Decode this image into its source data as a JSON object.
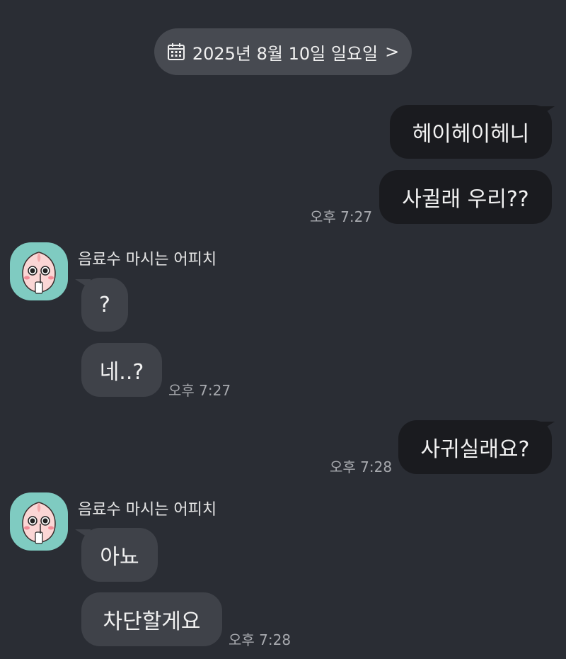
{
  "date_header": {
    "text": "2025년 8월 10일 일요일",
    "chevron": ">",
    "icon": "calendar-icon"
  },
  "messages": [
    {
      "from": "me",
      "text": "헤이헤이헤니"
    },
    {
      "from": "me",
      "text": "사귈래 우리??",
      "time": "오후 7:27"
    },
    {
      "from": "them",
      "sender": "음료수 마시는 어피치",
      "text": "?"
    },
    {
      "from": "them",
      "text": "네..?",
      "time": "오후 7:27"
    },
    {
      "from": "me",
      "text": "사귀실래요?",
      "time": "오후 7:28"
    },
    {
      "from": "them",
      "sender": "음료수 마시는 어피치",
      "text": "아뇨"
    },
    {
      "from": "them",
      "text": "차단할게요",
      "time": "오후 7:28"
    }
  ],
  "colors": {
    "background": "#2a2d34",
    "my_bubble": "#1a1b1f",
    "their_bubble": "#3f4249",
    "avatar_bg": "#7fcbc1"
  }
}
